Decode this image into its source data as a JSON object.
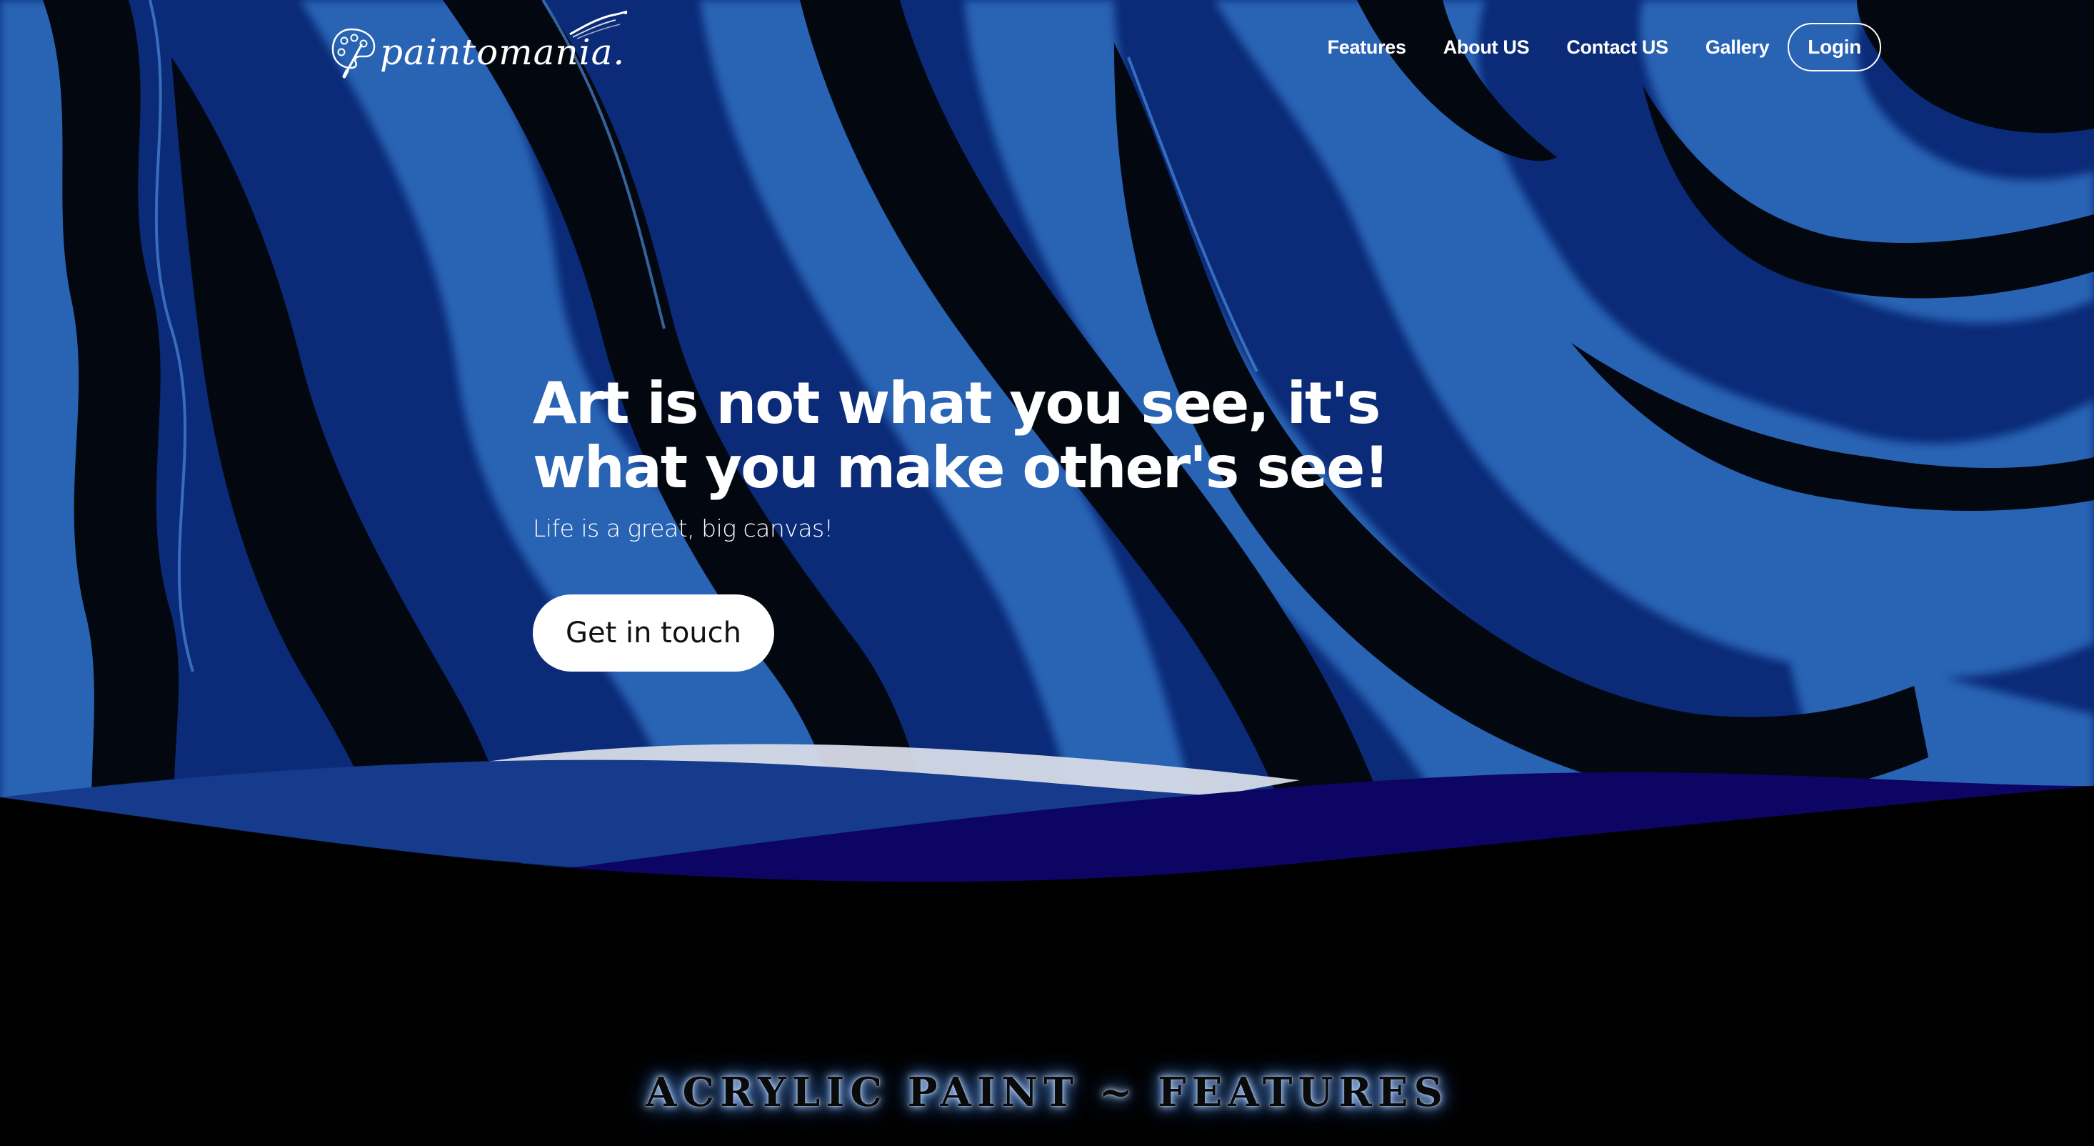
{
  "brand": {
    "name": "paintomania.",
    "logo_icon": "palette-icon"
  },
  "nav": {
    "links": [
      "Features",
      "About US",
      "Contact US",
      "Gallery"
    ],
    "login_label": "Login"
  },
  "hero": {
    "title": "Art is not what you see, it's what you make other's see!",
    "subtitle": "Life is a great, big canvas!",
    "cta_label": "Get in touch"
  },
  "section": {
    "title": "ACRYLIC PAINT ~ FEATURES"
  },
  "colors": {
    "hero_blue": "#0b2b78",
    "hero_light_blue": "#2f6fc0",
    "hero_dark": "#03070f",
    "wave_blue": "#163a8c",
    "wave_indigo": "#0d0564",
    "wave_white": "#d6dbe8",
    "background": "#000000"
  }
}
